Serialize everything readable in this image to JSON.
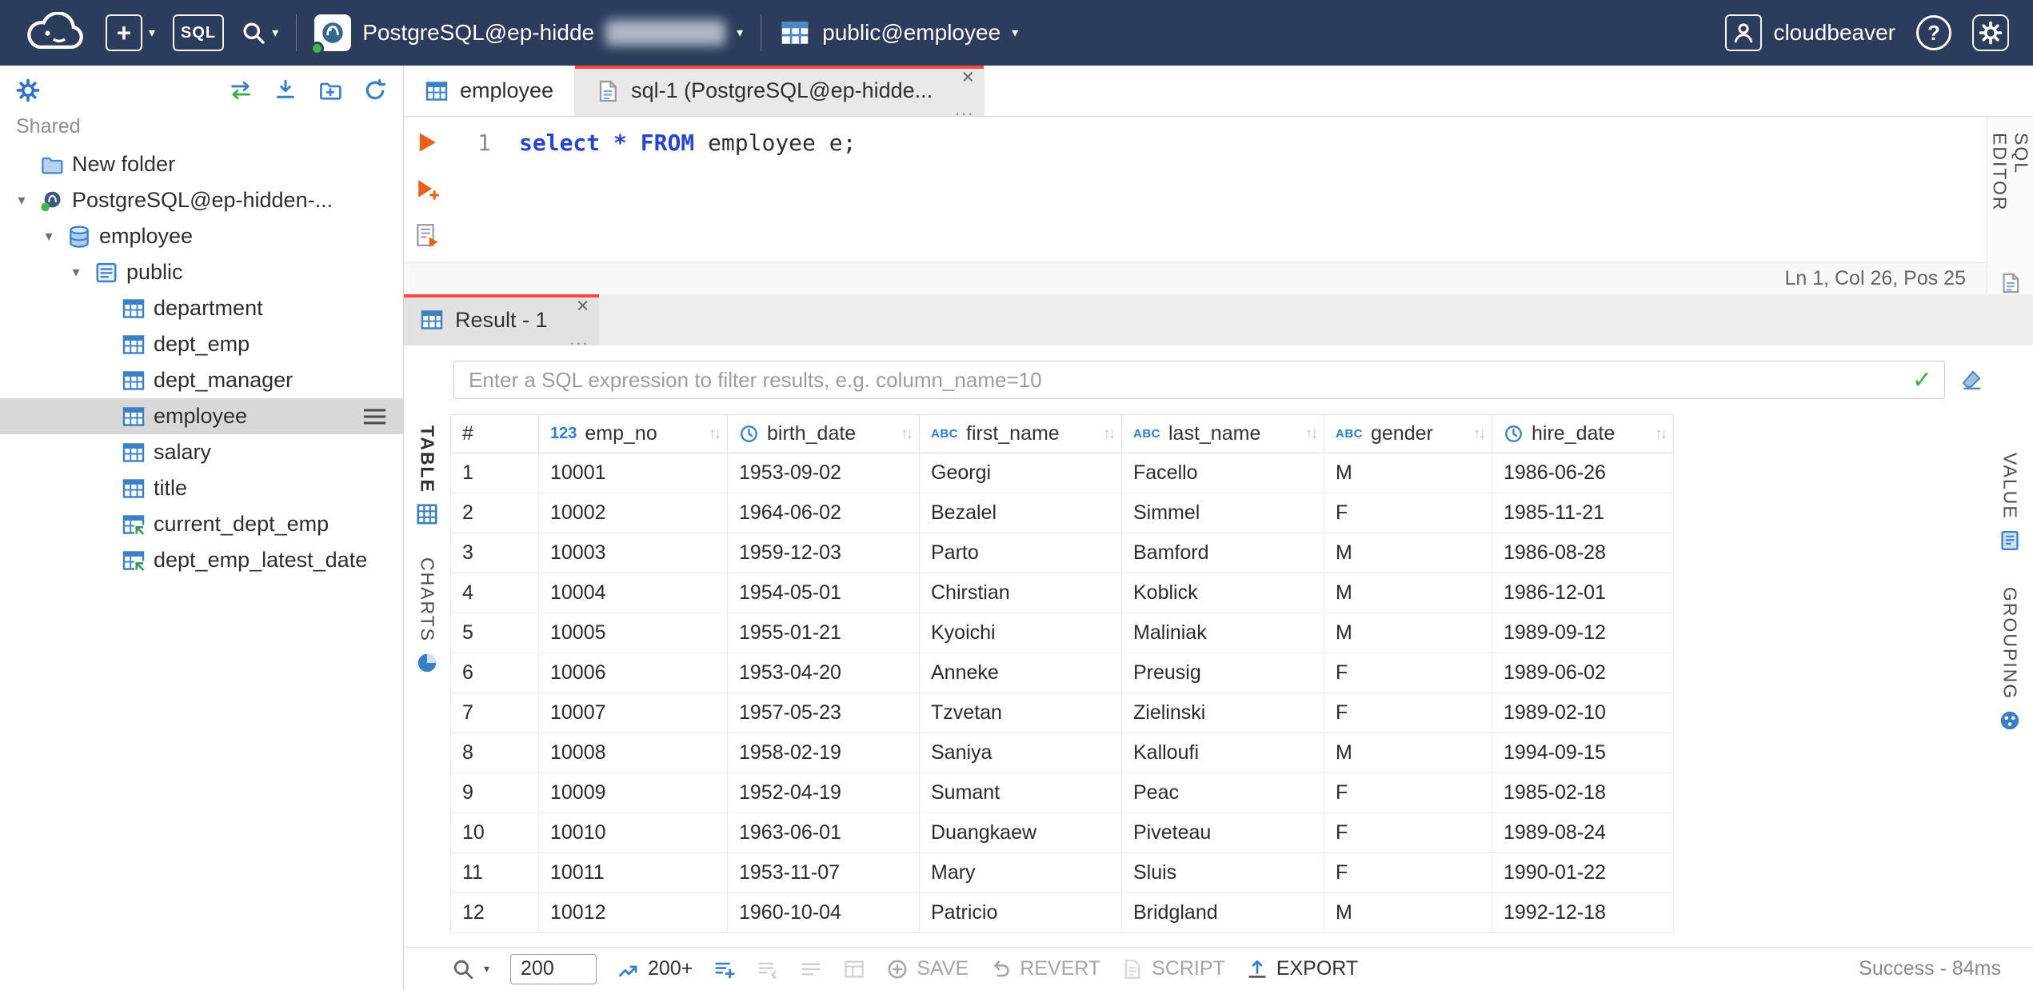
{
  "icons": {
    "close": "×",
    "caret": "▾",
    "sort": "↑↓",
    "check": "✓",
    "question": "?",
    "menu_dots": "..."
  },
  "topbar": {
    "new_button": "+",
    "sql_button": "SQL",
    "connection_label": "PostgreSQL@ep-hidde",
    "schema_label": "public@employee",
    "user_label": "cloudbeaver"
  },
  "sidebar": {
    "shared_label": "Shared",
    "tree": [
      {
        "label": "New folder",
        "icon": "folder",
        "level": 0,
        "expanded": false,
        "selected": false
      },
      {
        "label": "PostgreSQL@ep-hidden-...",
        "icon": "connection",
        "level": 0,
        "expanded": true,
        "selected": false
      },
      {
        "label": "employee",
        "icon": "database",
        "level": 1,
        "expanded": true,
        "selected": false
      },
      {
        "label": "public",
        "icon": "schema",
        "level": 2,
        "expanded": true,
        "selected": false
      },
      {
        "label": "department",
        "icon": "table",
        "level": 3,
        "expanded": false,
        "selected": false
      },
      {
        "label": "dept_emp",
        "icon": "table",
        "level": 3,
        "expanded": false,
        "selected": false
      },
      {
        "label": "dept_manager",
        "icon": "table",
        "level": 3,
        "expanded": false,
        "selected": false
      },
      {
        "label": "employee",
        "icon": "table",
        "level": 3,
        "expanded": false,
        "selected": true
      },
      {
        "label": "salary",
        "icon": "table",
        "level": 3,
        "expanded": false,
        "selected": false
      },
      {
        "label": "title",
        "icon": "table",
        "level": 3,
        "expanded": false,
        "selected": false
      },
      {
        "label": "current_dept_emp",
        "icon": "view",
        "level": 3,
        "expanded": false,
        "selected": false
      },
      {
        "label": "dept_emp_latest_date",
        "icon": "view",
        "level": 3,
        "expanded": false,
        "selected": false
      }
    ]
  },
  "editor": {
    "tabs": [
      {
        "label": "employee",
        "icon": "table",
        "active": false,
        "closable": false,
        "menu": ""
      },
      {
        "label": "sql-1 (PostgreSQL@ep-hidde...",
        "icon": "sql-file",
        "active": true,
        "closable": true,
        "menu": "..."
      }
    ],
    "line_number": "1",
    "code": [
      {
        "t": "select",
        "c": "kw"
      },
      {
        "t": " ",
        "c": "pl"
      },
      {
        "t": "*",
        "c": "kw"
      },
      {
        "t": " ",
        "c": "pl"
      },
      {
        "t": "FROM",
        "c": "kw"
      },
      {
        "t": " employee e;",
        "c": "pl"
      }
    ],
    "status": "Ln 1, Col 26, Pos 25",
    "side_label": "SQL EDITOR"
  },
  "result": {
    "tab_label": "Result - 1",
    "tab_menu": "...",
    "filter_placeholder": "Enter a SQL expression to filter results, e.g. column_name=10",
    "left_tabs": [
      {
        "label": "TABLE",
        "icon": "grid",
        "active": true
      },
      {
        "label": "CHARTS",
        "icon": "pie",
        "active": false
      }
    ],
    "right_tabs": [
      {
        "label": "VALUE",
        "icon": "value",
        "active": false
      },
      {
        "label": "GROUPING",
        "icon": "grouping",
        "active": false
      }
    ]
  },
  "grid": {
    "row_number_header": "#",
    "type_badges": {
      "number": "123",
      "text": "ABC"
    },
    "columns": [
      {
        "name": "emp_no",
        "type": "number"
      },
      {
        "name": "birth_date",
        "type": "date"
      },
      {
        "name": "first_name",
        "type": "text"
      },
      {
        "name": "last_name",
        "type": "text"
      },
      {
        "name": "gender",
        "type": "text"
      },
      {
        "name": "hire_date",
        "type": "date"
      }
    ],
    "rows": [
      [
        "1",
        "10001",
        "1953-09-02",
        "Georgi",
        "Facello",
        "M",
        "1986-06-26"
      ],
      [
        "2",
        "10002",
        "1964-06-02",
        "Bezalel",
        "Simmel",
        "F",
        "1985-11-21"
      ],
      [
        "3",
        "10003",
        "1959-12-03",
        "Parto",
        "Bamford",
        "M",
        "1986-08-28"
      ],
      [
        "4",
        "10004",
        "1954-05-01",
        "Chirstian",
        "Koblick",
        "M",
        "1986-12-01"
      ],
      [
        "5",
        "10005",
        "1955-01-21",
        "Kyoichi",
        "Maliniak",
        "M",
        "1989-09-12"
      ],
      [
        "6",
        "10006",
        "1953-04-20",
        "Anneke",
        "Preusig",
        "F",
        "1989-06-02"
      ],
      [
        "7",
        "10007",
        "1957-05-23",
        "Tzvetan",
        "Zielinski",
        "F",
        "1989-02-10"
      ],
      [
        "8",
        "10008",
        "1958-02-19",
        "Saniya",
        "Kalloufi",
        "M",
        "1994-09-15"
      ],
      [
        "9",
        "10009",
        "1952-04-19",
        "Sumant",
        "Peac",
        "F",
        "1985-02-18"
      ],
      [
        "10",
        "10010",
        "1963-06-01",
        "Duangkaew",
        "Piveteau",
        "F",
        "1989-08-24"
      ],
      [
        "11",
        "10011",
        "1953-11-07",
        "Mary",
        "Sluis",
        "F",
        "1990-01-22"
      ],
      [
        "12",
        "10012",
        "1960-10-04",
        "Patricio",
        "Bridgland",
        "M",
        "1992-12-18"
      ]
    ]
  },
  "bottom": {
    "fetch_size": "200",
    "fetch_more": "200+",
    "save": "SAVE",
    "revert": "REVERT",
    "script": "SCRIPT",
    "export": "EXPORT",
    "status": "Success - 84ms"
  }
}
